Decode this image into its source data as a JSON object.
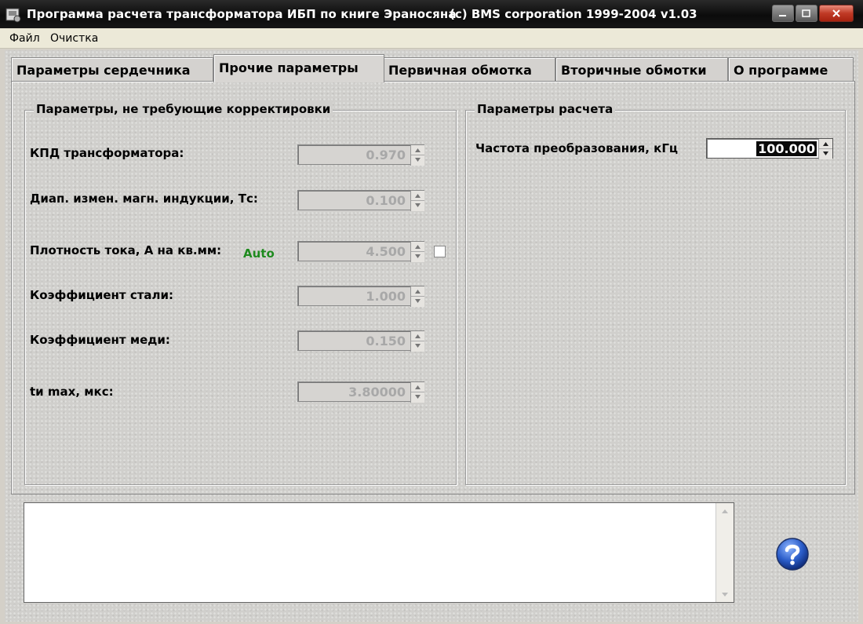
{
  "window": {
    "title": "Программа расчета трансформатора ИБП по книге Эраносяна",
    "copyright": "(c) BMS corporation 1999-2004  v1.03"
  },
  "menu": {
    "items": [
      "Файл",
      "Очистка"
    ]
  },
  "tabs": [
    {
      "label": "Параметры сердечника"
    },
    {
      "label": "Прочие параметры",
      "active": true
    },
    {
      "label": "Первичная обмотка"
    },
    {
      "label": "Вторичные обмотки"
    },
    {
      "label": "О программе"
    }
  ],
  "left_group": {
    "title": "Параметры, не требующие корректировки",
    "fields": [
      {
        "label": "КПД трансформатора:",
        "value": "0.970"
      },
      {
        "label": "Диап. измен. магн. индукции, Тс:",
        "value": "0.100"
      },
      {
        "label": "Плотность тока, А на кв.мм:",
        "value": "4.500",
        "auto_label": "Auto",
        "auto_checked": false
      },
      {
        "label": "Коэффициент стали:",
        "value": "1.000"
      },
      {
        "label": "Коэффициент меди:",
        "value": "0.150"
      },
      {
        "label": "tи max, мкс:",
        "value": "3.80000"
      }
    ]
  },
  "right_group": {
    "title": "Параметры расчета",
    "frequency": {
      "label": "Частота  преобразования, кГц",
      "value": "100.000"
    }
  },
  "memo": {
    "text": ""
  },
  "icons": {
    "app": "app-icon",
    "minimize": "minimize-icon",
    "maximize": "maximize-icon",
    "close": "close-icon",
    "help": "help-icon"
  },
  "colors": {
    "auto_label": "#1e8a1e",
    "close_button": "#c03a26",
    "help_button": "#2a5cc8"
  }
}
